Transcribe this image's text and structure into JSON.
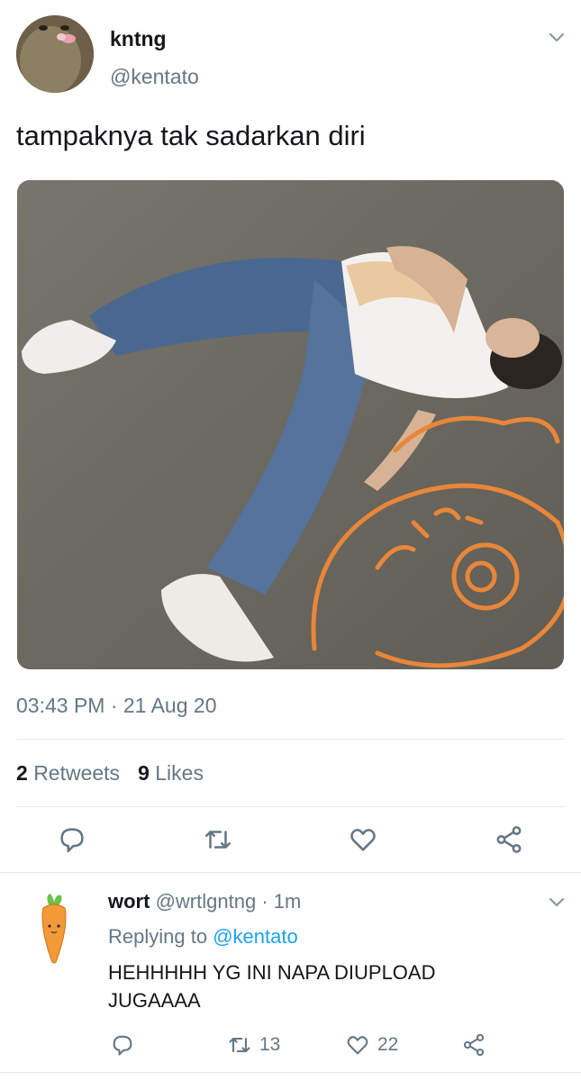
{
  "tweet": {
    "display_name": "kntng",
    "handle": "@kentato",
    "text": "tampaknya tak sadarkan diri",
    "timestamp": "03:43 PM · 21 Aug 20",
    "retweets_count": "2",
    "retweets_label": "Retweets",
    "likes_count": "9",
    "likes_label": "Likes",
    "image_description": "",
    "actions": [
      "reply-icon",
      "retweet-icon",
      "like-icon",
      "share-icon"
    ]
  },
  "reply": {
    "display_name": "wort",
    "handle": "@wrtlgntng",
    "separator": "·",
    "time": "1m",
    "replying_to_label": "Replying to",
    "replying_to_handle": "@kentato",
    "text": "HEHHHHH YG INI NAPA DIUPLOAD JUGAAAA",
    "retweets": "13",
    "likes": "22"
  },
  "colors": {
    "text": "#14171a",
    "secondary": "#657786",
    "accent": "#1da1f2",
    "divider": "#e1e8ed",
    "carrot": "#f29a38"
  }
}
